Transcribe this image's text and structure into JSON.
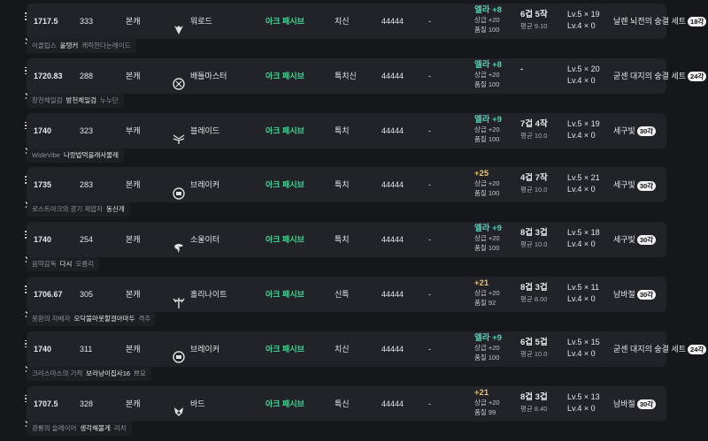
{
  "colors": {
    "background": "#15171b",
    "card": "#212329",
    "ark_passive": "#48d597",
    "quality_teal": "#4fd1b4",
    "quality_gold": "#e8c06e"
  },
  "rows": [
    {
      "item_level": "1717.5",
      "combat_power": "333",
      "character_type": "본캐",
      "class_icon": "slayer-icon",
      "class_name": "워로드",
      "ark_passive": "아크 패시브",
      "engraving": "치신",
      "points": "44444",
      "dash": "-",
      "quality_top": "엘라 +8",
      "quality_tier": "teal",
      "quality_sub1": "상급 +20",
      "quality_sub2": "품질 100",
      "gem_top": "6겁 5작",
      "gem_sub": "평균 9.10",
      "lv_line1": "Lv.5 × 19",
      "lv_line2": "Lv.4 × 0",
      "set_name": "날렌 뇌전의 숭결 세트",
      "set_badge": "18각",
      "names": [
        "이클립스",
        "올탱커",
        "캐릭한다는레이드"
      ]
    },
    {
      "item_level": "1720.83",
      "combat_power": "288",
      "character_type": "본캐",
      "class_icon": "battlemaster-icon",
      "class_name": "배틀마스터",
      "ark_passive": "아크 패시브",
      "engraving": "특치신",
      "points": "44444",
      "dash": "-",
      "quality_top": "엘라 +8",
      "quality_tier": "teal",
      "quality_sub1": "상급 +20",
      "quality_sub2": "품질 100",
      "gem_top": "-",
      "gem_sub": "",
      "lv_line1": "Lv.5 × 20",
      "lv_line2": "Lv.4 × 0",
      "set_name": "굳센 대지의 숭결 세트",
      "set_badge": "24각",
      "names": [
        "창천체일검",
        "방천체일검",
        "누누단"
      ]
    },
    {
      "item_level": "1740",
      "combat_power": "323",
      "character_type": "부캐",
      "class_icon": "blade-icon",
      "class_name": "블레이드",
      "ark_passive": "아크 패시브",
      "engraving": "특치",
      "points": "44444",
      "dash": "-",
      "quality_top": "엘라 +9",
      "quality_tier": "teal",
      "quality_sub1": "상급 +20",
      "quality_sub2": "품질 100",
      "gem_top": "7겁 4작",
      "gem_sub": "평균 10.0",
      "lv_line1": "Lv.5 × 19",
      "lv_line2": "Lv.4 × 0",
      "set_name": "세구빛",
      "set_badge": "30각",
      "names": [
        "WideVibe",
        "나랑밥먹을래사물레",
        ""
      ]
    },
    {
      "item_level": "1735",
      "combat_power": "283",
      "character_type": "본캐",
      "class_icon": "breaker-icon",
      "class_name": "브레이커",
      "ark_passive": "아크 패시브",
      "engraving": "특치",
      "points": "44444",
      "dash": "-",
      "quality_top": "+25",
      "quality_tier": "gold",
      "quality_sub1": "상급 +20",
      "quality_sub2": "품질 100",
      "gem_top": "4겁 7작",
      "gem_sub": "평균 10.0",
      "lv_line1": "Lv.5 × 21",
      "lv_line2": "Lv.4 × 0",
      "set_name": "세구빛",
      "set_badge": "30각",
      "names": [
        "로스트아크의 광기 제압자",
        "동산개",
        ""
      ]
    },
    {
      "item_level": "1740",
      "combat_power": "254",
      "character_type": "본캐",
      "class_icon": "soul-eater-icon",
      "class_name": "소울이터",
      "ark_passive": "아크 패시브",
      "engraving": "특치",
      "points": "44444",
      "dash": "-",
      "quality_top": "엘라 +9",
      "quality_tier": "teal",
      "quality_sub1": "상급 +20",
      "quality_sub2": "품질 100",
      "gem_top": "8겁 3겁",
      "gem_sub": "평균 10.0",
      "lv_line1": "Lv.5 × 18",
      "lv_line2": "Lv.4 × 0",
      "set_name": "세구빛",
      "set_badge": "30각",
      "names": [
        "음막감독",
        "다시",
        "오름리"
      ]
    },
    {
      "item_level": "1706.67",
      "combat_power": "305",
      "character_type": "본캐",
      "class_icon": "holyknight-icon",
      "class_name": "홀리나이트",
      "ark_passive": "아크 패시브",
      "engraving": "신특",
      "points": "44444",
      "dash": "-",
      "quality_top": "+21",
      "quality_tier": "gold",
      "quality_sub1": "상급 +20",
      "quality_sub2": "품질 92",
      "gem_top": "8겁 3겁",
      "gem_sub": "평균 8.00",
      "lv_line1": "Lv.5 × 11",
      "lv_line2": "Lv.4 × 0",
      "set_name": "남바절",
      "set_badge": "30각",
      "names": [
        "몽환의 자베자",
        "모닥불마못할걸아마두",
        "격추"
      ]
    },
    {
      "item_level": "1740",
      "combat_power": "311",
      "character_type": "본캐",
      "class_icon": "breaker-icon",
      "class_name": "브레이커",
      "ark_passive": "아크 패시브",
      "engraving": "치신",
      "points": "44444",
      "dash": "-",
      "quality_top": "엘라 +9",
      "quality_tier": "teal",
      "quality_sub1": "상급 +20",
      "quality_sub2": "품질 100",
      "gem_top": "6겁 5겁",
      "gem_sub": "평균 10.0",
      "lv_line1": "Lv.5 × 15",
      "lv_line2": "Lv.4 × 0",
      "set_name": "굳센 대지의 숭결 세트",
      "set_badge": "24각",
      "names": [
        "크리스마스의 기적",
        "보라냥이집사16",
        "쁘요"
      ]
    },
    {
      "item_level": "1707.5",
      "combat_power": "328",
      "character_type": "본캐",
      "class_icon": "bard-icon",
      "class_name": "바드",
      "ark_passive": "아크 패시브",
      "engraving": "특신",
      "points": "44444",
      "dash": "-",
      "quality_top": "+21",
      "quality_tier": "gold",
      "quality_sub1": "상급 +20",
      "quality_sub2": "품질 99",
      "gem_top": "8겁 3겁",
      "gem_sub": "평균 8.40",
      "lv_line1": "Lv.5 × 13",
      "lv_line2": "Lv.4 × 0",
      "set_name": "남바절",
      "set_badge": "30각",
      "names": [
        "광룡의 슬레이어",
        "생각해볼게",
        "리치"
      ]
    }
  ]
}
